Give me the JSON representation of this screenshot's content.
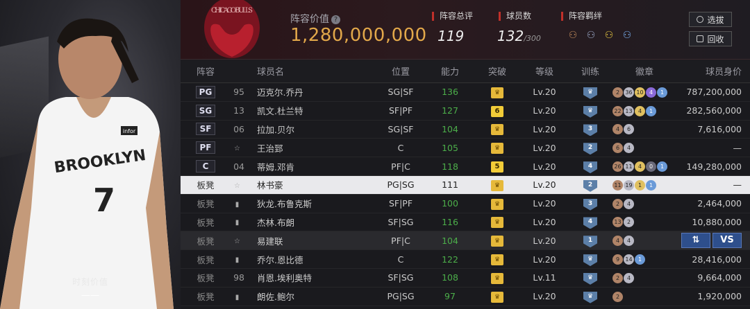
{
  "player_card": {
    "value_label": "时刻价值",
    "value": "——",
    "jersey_team": "BROOKLYN",
    "jersey_number": "7",
    "jersey_patch": "infor"
  },
  "header": {
    "team_logo_text": "CHICAGO BULLS",
    "lineup_value_label": "阵容价值",
    "lineup_value": "1,280,000,000",
    "rating_label": "阵容总评",
    "rating_value": "119",
    "count_label": "球员数",
    "count_value": "132",
    "count_total": "/300",
    "bond_label": "阵容羁绊",
    "select_button": "选拔",
    "recycle_button": "回收"
  },
  "columns": [
    "阵容",
    "球员名",
    "位置",
    "能力",
    "突破",
    "等级",
    "训练",
    "徽章",
    "球员身价"
  ],
  "rows": [
    {
      "slot": "PG",
      "num": "95",
      "name": "迈克尔.乔丹",
      "position": "SG|SF",
      "ability": "136",
      "breakthrough": "♛",
      "level": "Lv.20",
      "training": "♛",
      "badges": [
        [
          "h-bronze",
          "2"
        ],
        [
          "h-silver",
          "36"
        ],
        [
          "h-gold",
          "10"
        ],
        [
          "h-purple",
          "4"
        ],
        [
          "h-blue",
          "1"
        ]
      ],
      "price": "787,200,000"
    },
    {
      "slot": "SG",
      "num": "13",
      "name": "凯文.杜兰特",
      "position": "SF|PF",
      "ability": "127",
      "breakthrough": "6",
      "level": "Lv.20",
      "training": "♛",
      "badges": [
        [
          "h-bronze",
          "22"
        ],
        [
          "h-silver",
          "13"
        ],
        [
          "h-gold",
          "4"
        ],
        [
          "h-blue",
          "1"
        ]
      ],
      "price": "282,560,000"
    },
    {
      "slot": "SF",
      "num": "06",
      "name": "拉加.贝尔",
      "position": "SG|SF",
      "ability": "104",
      "breakthrough": "♛",
      "level": "Lv.20",
      "training": "3",
      "badges": [
        [
          "h-bronze",
          "4"
        ],
        [
          "h-silver",
          "6"
        ]
      ],
      "price": "7,616,000"
    },
    {
      "slot": "PF",
      "num": "",
      "name": "王治郅",
      "position": "C",
      "ability": "105",
      "breakthrough": "♛",
      "level": "Lv.20",
      "training": "2",
      "badges": [
        [
          "h-bronze",
          "6"
        ],
        [
          "h-silver",
          "4"
        ]
      ],
      "price": "—"
    },
    {
      "slot": "C",
      "num": "04",
      "name": "蒂姆.邓肯",
      "position": "PF|C",
      "ability": "118",
      "breakthrough": "5",
      "level": "Lv.20",
      "training": "4",
      "badges": [
        [
          "h-bronze",
          "26"
        ],
        [
          "h-silver",
          "11"
        ],
        [
          "h-gold",
          "4"
        ],
        [
          "h-dark",
          "0"
        ],
        [
          "h-blue",
          "1"
        ]
      ],
      "price": "149,280,000"
    },
    {
      "slot": "板凳",
      "num": "",
      "name": "林书豪",
      "position": "PG|SG",
      "ability": "111",
      "breakthrough": "♛",
      "level": "Lv.20",
      "training": "2",
      "badges": [
        [
          "h-bronze",
          "11"
        ],
        [
          "h-silver",
          "19"
        ],
        [
          "h-gold",
          "1"
        ],
        [
          "h-blue",
          "1"
        ]
      ],
      "price": "—",
      "highlight": true
    },
    {
      "slot": "板凳",
      "num": "",
      "name": "狄龙.布鲁克斯",
      "position": "SF|PF",
      "ability": "100",
      "breakthrough": "♛",
      "level": "Lv.20",
      "training": "3",
      "badges": [
        [
          "h-bronze",
          "2"
        ],
        [
          "h-silver",
          "4"
        ]
      ],
      "price": "2,464,000"
    },
    {
      "slot": "板凳",
      "num": "",
      "name": "杰林.布朗",
      "position": "SF|SG",
      "ability": "116",
      "breakthrough": "♛",
      "level": "Lv.20",
      "training": "4",
      "badges": [
        [
          "h-bronze",
          "13"
        ],
        [
          "h-silver",
          "2"
        ]
      ],
      "price": "10,880,000"
    },
    {
      "slot": "板凳",
      "num": "",
      "name": "易建联",
      "position": "PF|C",
      "ability": "104",
      "breakthrough": "♛",
      "level": "Lv.20",
      "training": "1",
      "badges": [
        [
          "h-bronze",
          "4"
        ],
        [
          "h-silver",
          "4"
        ]
      ],
      "price": "",
      "dim": true,
      "vs": true
    },
    {
      "slot": "板凳",
      "num": "",
      "name": "乔尔.恩比德",
      "position": "C",
      "ability": "122",
      "breakthrough": "♛",
      "level": "Lv.20",
      "training": "♛",
      "badges": [
        [
          "h-bronze",
          "9"
        ],
        [
          "h-silver",
          "14"
        ],
        [
          "h-blue",
          "1"
        ]
      ],
      "price": "28,416,000"
    },
    {
      "slot": "板凳",
      "num": "98",
      "name": "肖恩.埃利奥特",
      "position": "SF|SG",
      "ability": "108",
      "breakthrough": "♛",
      "level": "Lv.11",
      "training": "♛",
      "badges": [
        [
          "h-bronze",
          "2"
        ],
        [
          "h-silver",
          "4"
        ]
      ],
      "price": "9,664,000"
    },
    {
      "slot": "板凳",
      "num": "",
      "name": "朗佐.鲍尔",
      "position": "PG|SG",
      "ability": "97",
      "breakthrough": "♛",
      "level": "Lv.20",
      "training": "♛",
      "badges": [
        [
          "h-bronze",
          "2"
        ]
      ],
      "price": "1,920,000"
    }
  ],
  "vs_buttons": {
    "swap": "⇅",
    "vs": "VS"
  }
}
